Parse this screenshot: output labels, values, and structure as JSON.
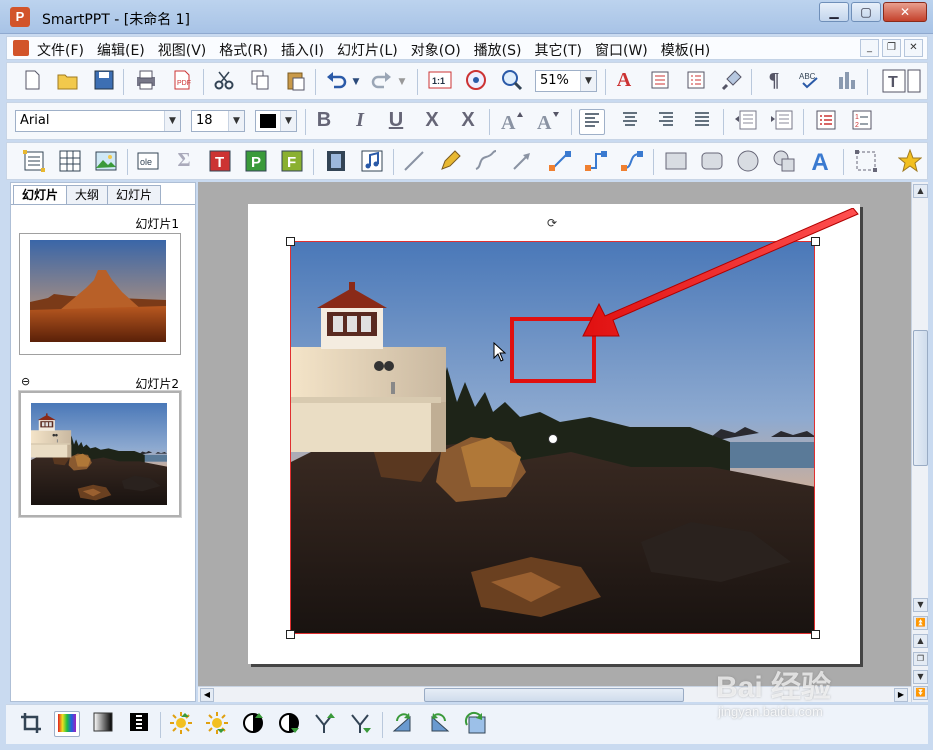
{
  "window": {
    "title": "SmartPPT    - [未命名 1]",
    "app_icon_letter": "P",
    "minimize": "▁",
    "maximize": "▢",
    "close": "✕"
  },
  "menu": {
    "items": [
      "文件(F)",
      "编辑(E)",
      "视图(V)",
      "格式(R)",
      "插入(I)",
      "幻灯片(L)",
      "对象(O)",
      "播放(S)",
      "其它(T)",
      "窗口(W)",
      "模板(H)"
    ],
    "mdi_minimize": "_",
    "mdi_restore": "❐",
    "mdi_close": "✕"
  },
  "toolbar1": {
    "zoom_value": "51%",
    "icons": [
      "new-icon",
      "open-icon",
      "save-icon",
      "print-icon",
      "pdf-icon",
      "cut-icon",
      "copy-icon",
      "paste-icon",
      "undo-icon",
      "redo-icon",
      "actual-size-icon",
      "navigator-icon",
      "zoom-icon",
      "text-color-icon",
      "paragraph-style-icon",
      "list-style-icon",
      "format-painter-icon",
      "pilcrow-icon",
      "spellcheck-icon",
      "chart-tool-icon",
      "text-box-icon"
    ]
  },
  "toolbar2": {
    "font_name": "Arial",
    "font_size": "18",
    "bold": "B",
    "italic": "I",
    "underline": "U",
    "strike": "X",
    "x2": "X"
  },
  "left_panel": {
    "tabs": [
      "幻灯片",
      "大纲",
      "幻灯片"
    ],
    "slides": [
      {
        "label": "幻灯片1"
      },
      {
        "label": "幻灯片2"
      }
    ]
  },
  "colors": {
    "selection_border": "#e03030",
    "highlight_box": "#e01010",
    "arrow": "#e01010",
    "canvas_bg": "#ababab"
  },
  "watermark": {
    "main": "Bai 经验",
    "url": "jingyan.baidu.com"
  }
}
